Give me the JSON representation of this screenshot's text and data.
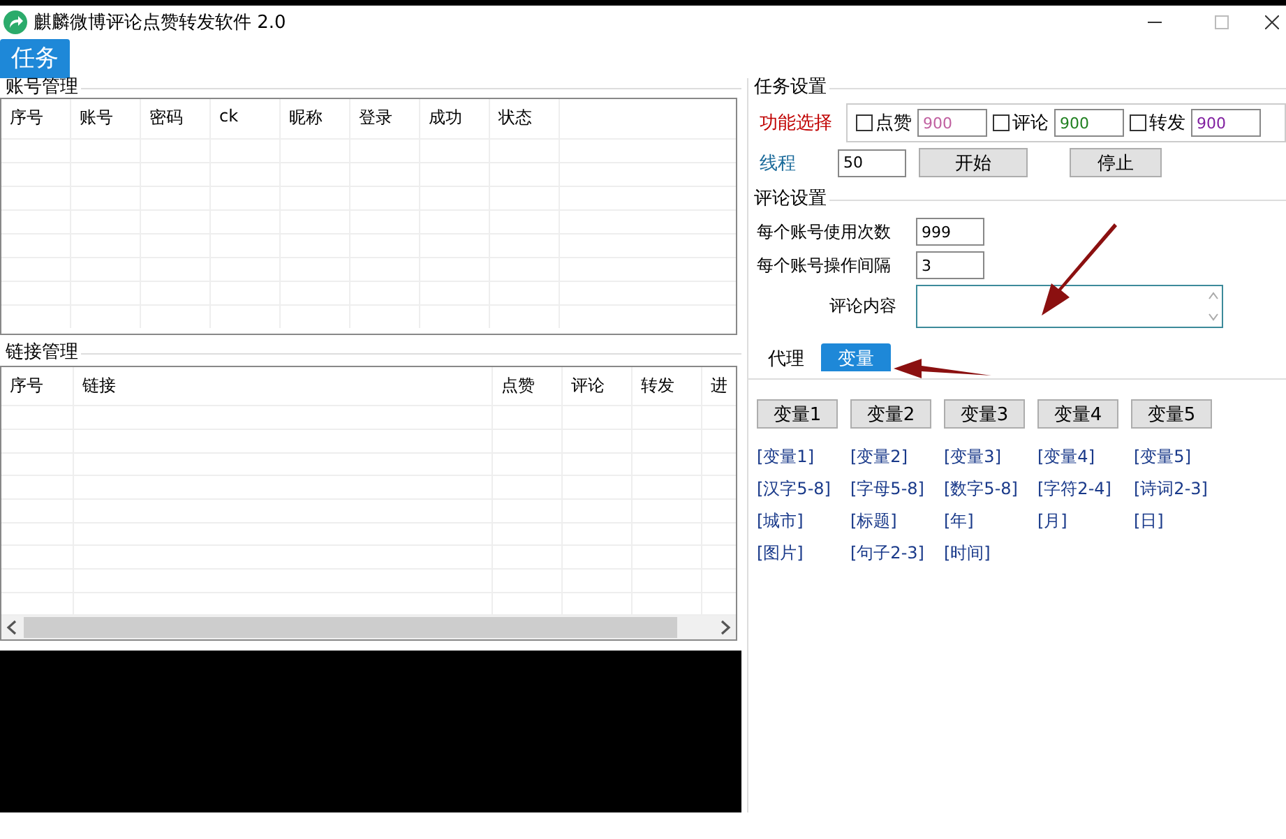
{
  "window": {
    "title": "麒麟微博评论点赞转发软件 2.0"
  },
  "main_tab": {
    "label": "任务",
    "selected": true
  },
  "account_group": {
    "title": "账号管理",
    "columns": [
      "序号",
      "账号",
      "密码",
      "ck",
      "昵称",
      "登录",
      "成功",
      "状态"
    ]
  },
  "link_group": {
    "title": "链接管理",
    "columns": [
      "序号",
      "链接",
      "点赞",
      "评论",
      "转发",
      "进"
    ]
  },
  "task_settings": {
    "title": "任务设置",
    "function_label": "功能选择",
    "options": [
      {
        "label": "点赞",
        "checked": false,
        "value": "900",
        "color": "#c060a0"
      },
      {
        "label": "评论",
        "checked": false,
        "value": "900",
        "color": "#208020"
      },
      {
        "label": "转发",
        "checked": false,
        "value": "900",
        "color": "#8020a0"
      }
    ],
    "thread_label": "线程",
    "thread_value": "50",
    "buttons": [
      "开始",
      "停止"
    ]
  },
  "comment_settings": {
    "title": "评论设置",
    "fields": [
      {
        "label": "每个账号使用次数",
        "value": "999"
      },
      {
        "label": "每个账号操作间隔",
        "value": "3"
      }
    ],
    "content_label": "评论内容"
  },
  "tabs": [
    {
      "label": "代理",
      "selected": false
    },
    {
      "label": "变量",
      "selected": true
    }
  ],
  "variable_buttons": [
    "变量1",
    "变量2",
    "变量3",
    "变量4",
    "变量5"
  ],
  "variable_tokens": [
    "[变量1]",
    "[变量2]",
    "[变量3]",
    "[变量4]",
    "[变量5]",
    "[汉字5-8]",
    "[字母5-8]",
    "[数字5-8]",
    "[字符2-4]",
    "[诗词2-3]",
    "[城市]",
    "[标题]",
    "[年]",
    "[月]",
    "[日]",
    "[图片]",
    "[句子2-3]",
    "[时间]"
  ]
}
